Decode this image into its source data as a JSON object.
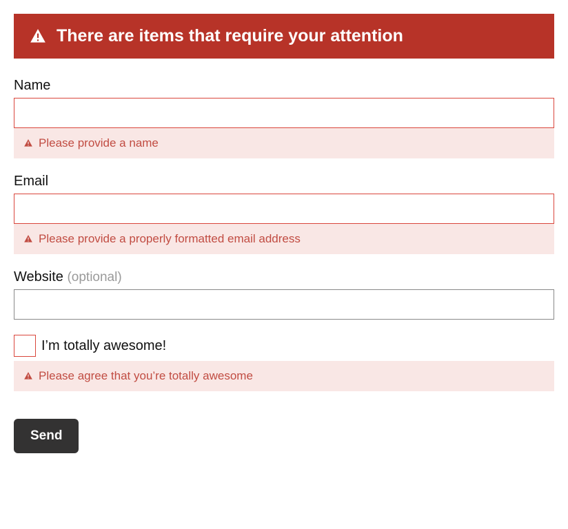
{
  "alert": {
    "title": "There are items that require your attention"
  },
  "fields": {
    "name": {
      "label": "Name",
      "value": "",
      "error": "Please provide a name"
    },
    "email": {
      "label": "Email",
      "value": "",
      "error": "Please provide a properly formatted email address"
    },
    "website": {
      "label": "Website",
      "optional_hint": "(optional)",
      "value": ""
    },
    "awesome": {
      "label": "I’m totally awesome!",
      "checked": false,
      "error": "Please agree that you’re totally awesome"
    }
  },
  "actions": {
    "submit_label": "Send"
  },
  "colors": {
    "error_primary": "#b73328",
    "error_bg": "#f9e7e5",
    "error_text": "#c14c42"
  }
}
